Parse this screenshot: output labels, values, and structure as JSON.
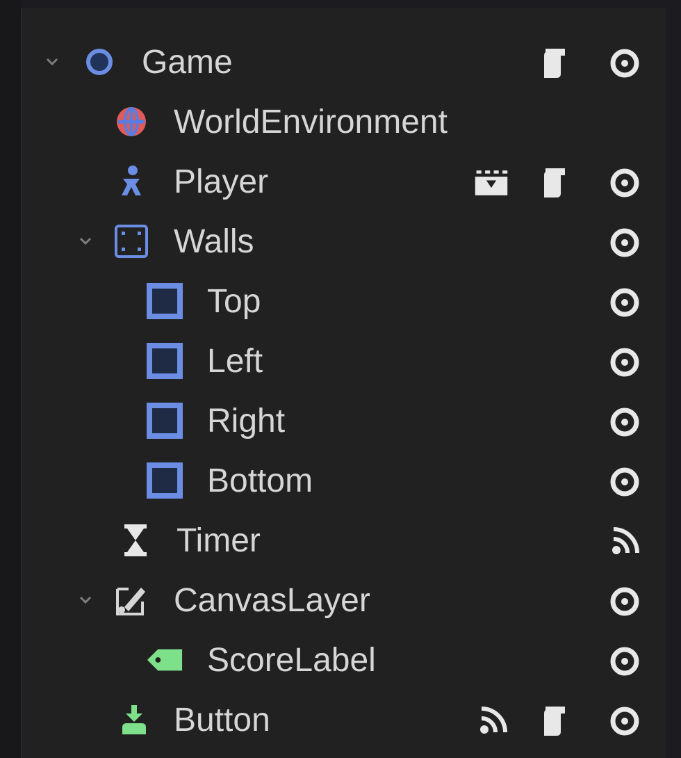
{
  "scene_tree": {
    "rows": [
      {
        "label": "Game",
        "node_type": "node2d-icon",
        "expanded": true,
        "status_icons": [
          "script-icon",
          "visibility-icon"
        ]
      },
      {
        "label": "WorldEnvironment",
        "node_type": "world-environment-icon",
        "status_icons": []
      },
      {
        "label": "Player",
        "node_type": "character-body-icon",
        "status_icons": [
          "instance-scene-icon",
          "script-icon",
          "visibility-icon"
        ]
      },
      {
        "label": "Walls",
        "node_type": "node2d-group-icon",
        "expanded": true,
        "status_icons": [
          "visibility-icon"
        ]
      },
      {
        "label": "Top",
        "node_type": "static-body-icon",
        "status_icons": [
          "visibility-icon"
        ]
      },
      {
        "label": "Left",
        "node_type": "static-body-icon",
        "status_icons": [
          "visibility-icon"
        ]
      },
      {
        "label": "Right",
        "node_type": "static-body-icon",
        "status_icons": [
          "visibility-icon"
        ]
      },
      {
        "label": "Bottom",
        "node_type": "static-body-icon",
        "status_icons": [
          "visibility-icon"
        ]
      },
      {
        "label": "Timer",
        "node_type": "timer-icon",
        "status_icons": [
          "signal-icon"
        ]
      },
      {
        "label": "CanvasLayer",
        "node_type": "canvas-layer-icon",
        "expanded": true,
        "status_icons": [
          "visibility-icon"
        ]
      },
      {
        "label": "ScoreLabel",
        "node_type": "label-icon",
        "status_icons": [
          "visibility-icon"
        ]
      },
      {
        "label": "Button",
        "node_type": "button-icon",
        "status_icons": [
          "signal-icon",
          "script-icon",
          "visibility-icon"
        ]
      }
    ]
  },
  "colors": {
    "background": "#212121",
    "text": "#d6d6d6",
    "node2d_blue": "#6b8de3",
    "control_green": "#7ee08a",
    "environment_red": "#e05a5a",
    "icon_white": "#e8e8e8"
  }
}
